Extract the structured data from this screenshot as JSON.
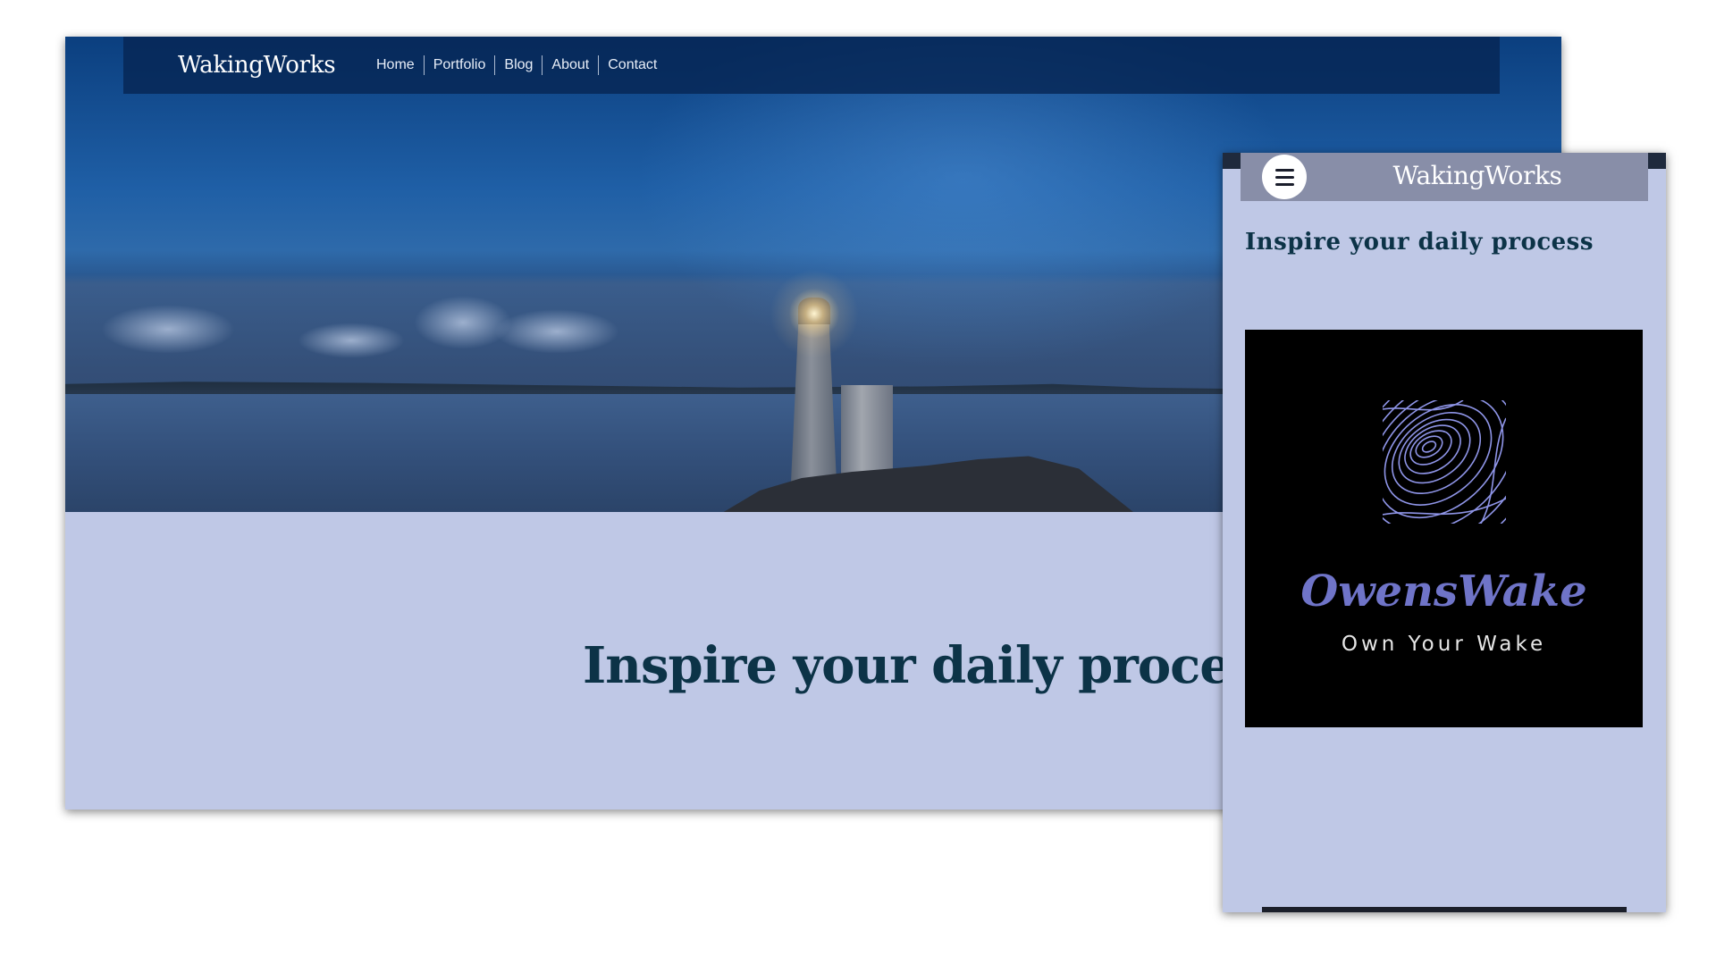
{
  "desktop": {
    "brand": "WakingWorks",
    "nav": [
      "Home",
      "Portfolio",
      "Blog",
      "About",
      "Contact"
    ],
    "hero_image": "lighthouse-at-night",
    "heading": "Inspire your daily process",
    "colors": {
      "nav_background": "#062654",
      "page_background": "#bfc8e6",
      "heading": "#0c3347"
    }
  },
  "mobile": {
    "menu_icon": "hamburger-menu-icon",
    "brand": "WakingWorks",
    "heading": "Inspire your daily process",
    "logo": {
      "icon": "fingerprint-icon",
      "title": "OwensWake",
      "tagline": "Own Your Wake",
      "colors": {
        "background": "#000000",
        "title": "#6f74c8",
        "tagline": "#e6e6e6"
      }
    }
  }
}
